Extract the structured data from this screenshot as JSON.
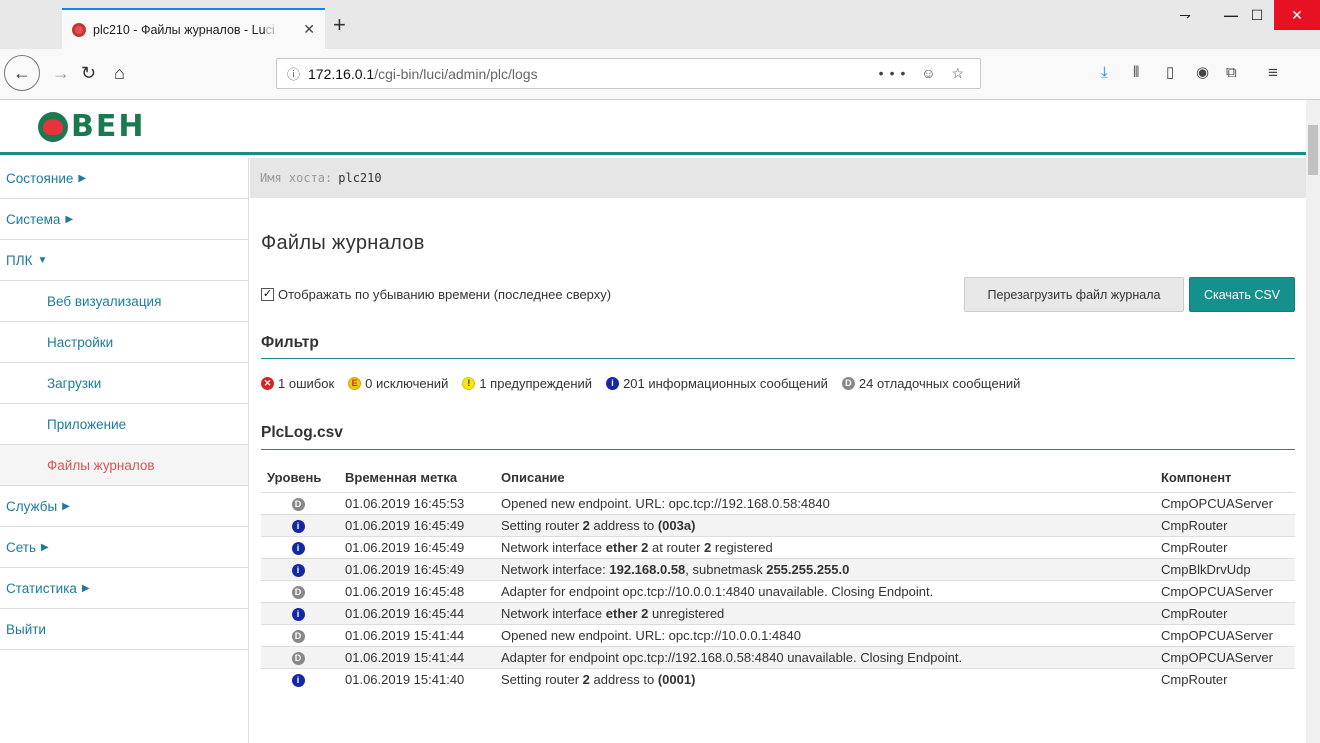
{
  "browser": {
    "tab_title": "plc210 - Файлы журналов - Lu",
    "tab_title_fade": "ci",
    "new_tab": "+",
    "url_host": "172.16.0.1",
    "url_path": "/cgi-bin/luci/admin/plc/logs",
    "url_actions": "••• ☺ ☆"
  },
  "header": {
    "logo_text": "ВЕН",
    "hostname_label": "Имя хоста:",
    "hostname_value": "plc210"
  },
  "sidebar": {
    "items": [
      {
        "label": "Состояние",
        "arrow": "▶"
      },
      {
        "label": "Система",
        "arrow": "▶"
      },
      {
        "label": "ПЛК",
        "arrow": "▼"
      },
      {
        "label": "Веб визуализация"
      },
      {
        "label": "Настройки"
      },
      {
        "label": "Загрузки"
      },
      {
        "label": "Приложение"
      },
      {
        "label": "Файлы журналов"
      },
      {
        "label": "Службы",
        "arrow": "▶"
      },
      {
        "label": "Сеть",
        "arrow": "▶"
      },
      {
        "label": "Статистика",
        "arrow": "▶"
      },
      {
        "label": "Выйти"
      }
    ]
  },
  "main": {
    "title": "Файлы журналов",
    "sort_checkbox_label": "Отображать по убыванию времени (последнее сверху)",
    "reload_button": "Перезагрузить файл журнала",
    "download_button": "Скачать CSV",
    "filter_title": "Фильтр",
    "filters": {
      "errors": "1 ошибок",
      "exceptions": "0 исключений",
      "warnings": "1 предупреждений",
      "info": "201 информационных сообщений",
      "debug": "24 отладочных сообщений"
    },
    "log_title": "PlcLog.csv",
    "columns": {
      "level": "Уровень",
      "timestamp": "Временная метка",
      "description": "Описание",
      "component": "Компонент"
    },
    "rows": [
      {
        "level": "debug",
        "timestamp": "01.06.2019 16:45:53",
        "component": "CmpOPCUAServer"
      },
      {
        "level": "info",
        "timestamp": "01.06.2019 16:45:49",
        "component": "CmpRouter"
      },
      {
        "level": "info",
        "timestamp": "01.06.2019 16:45:49",
        "component": "CmpRouter"
      },
      {
        "level": "info",
        "timestamp": "01.06.2019 16:45:49",
        "component": "CmpBlkDrvUdp"
      },
      {
        "level": "debug",
        "timestamp": "01.06.2019 16:45:48",
        "component": "CmpOPCUAServer"
      },
      {
        "level": "info",
        "timestamp": "01.06.2019 16:45:44",
        "component": "CmpRouter"
      },
      {
        "level": "debug",
        "timestamp": "01.06.2019 15:41:44",
        "component": "CmpOPCUAServer"
      },
      {
        "level": "debug",
        "timestamp": "01.06.2019 15:41:44",
        "component": "CmpOPCUAServer"
      },
      {
        "level": "info",
        "timestamp": "01.06.2019 15:41:40",
        "component": "CmpRouter"
      }
    ],
    "descriptions": {
      "r0": "Opened new endpoint. URL: opc.tcp://192.168.0.58:4840",
      "r1_a": "Setting router ",
      "r1_b": "2",
      "r1_c": " address to ",
      "r1_d": "(003a)",
      "r2_a": "Network interface ",
      "r2_b": "ether 2",
      "r2_c": " at router ",
      "r2_d": "2",
      "r2_e": " registered",
      "r3_a": "Network interface: ",
      "r3_b": "192.168.0.58",
      "r3_c": ", subnetmask ",
      "r3_d": "255.255.255.0",
      "r4": "Adapter for endpoint opc.tcp://10.0.0.1:4840 unavailable. Closing Endpoint.",
      "r5_a": "Network interface ",
      "r5_b": "ether 2",
      "r5_c": " unregistered",
      "r6": "Opened new endpoint. URL: opc.tcp://10.0.0.1:4840",
      "r7": "Adapter for endpoint opc.tcp://192.168.0.58:4840 unavailable. Closing Endpoint.",
      "r8_a": "Setting router ",
      "r8_b": "2",
      "r8_c": " address to ",
      "r8_d": "(0001)"
    }
  },
  "colors": {
    "accent": "#14918c",
    "link": "#1c7b9e",
    "active": "#d9534f"
  }
}
